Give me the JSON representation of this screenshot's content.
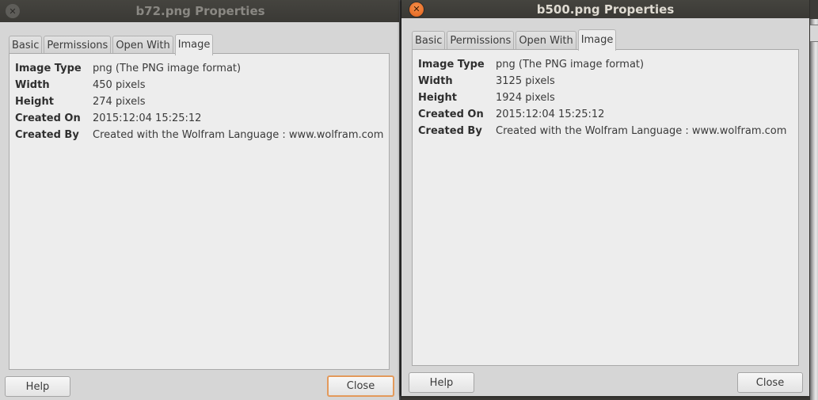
{
  "windows": [
    {
      "title": "b72.png Properties",
      "close_icon": "✕",
      "tabs": [
        {
          "label": "Basic",
          "active": false
        },
        {
          "label": "Permissions",
          "active": false
        },
        {
          "label": "Open With",
          "active": false
        },
        {
          "label": "Image",
          "active": true
        }
      ],
      "properties": [
        {
          "label": "Image Type",
          "value": "png (The PNG image format)"
        },
        {
          "label": "Width",
          "value": "450 pixels"
        },
        {
          "label": "Height",
          "value": "274 pixels"
        },
        {
          "label": "Created On",
          "value": "2015:12:04 15:25:12"
        },
        {
          "label": "Created By",
          "value": "Created with the Wolfram Language : www.wolfram.com"
        }
      ],
      "buttons": {
        "help": "Help",
        "close": "Close"
      },
      "focused": false
    },
    {
      "title": "b500.png Properties",
      "close_icon": "✕",
      "tabs": [
        {
          "label": "Basic",
          "active": false
        },
        {
          "label": "Permissions",
          "active": false
        },
        {
          "label": "Open With",
          "active": false
        },
        {
          "label": "Image",
          "active": true
        }
      ],
      "properties": [
        {
          "label": "Image Type",
          "value": "png (The PNG image format)"
        },
        {
          "label": "Width",
          "value": "3125 pixels"
        },
        {
          "label": "Height",
          "value": "1924 pixels"
        },
        {
          "label": "Created On",
          "value": "2015:12:04 15:25:12"
        },
        {
          "label": "Created By",
          "value": "Created with the Wolfram Language : www.wolfram.com"
        }
      ],
      "buttons": {
        "help": "Help",
        "close": "Close"
      },
      "focused": true
    }
  ],
  "colors": {
    "titlebar": "#3a3935",
    "active_close": "#e86a24",
    "inactive_close": "#5e5d59",
    "window_bg": "#d6d6d6",
    "panel_bg": "#ededed",
    "default_button_border": "#e39a5c"
  }
}
